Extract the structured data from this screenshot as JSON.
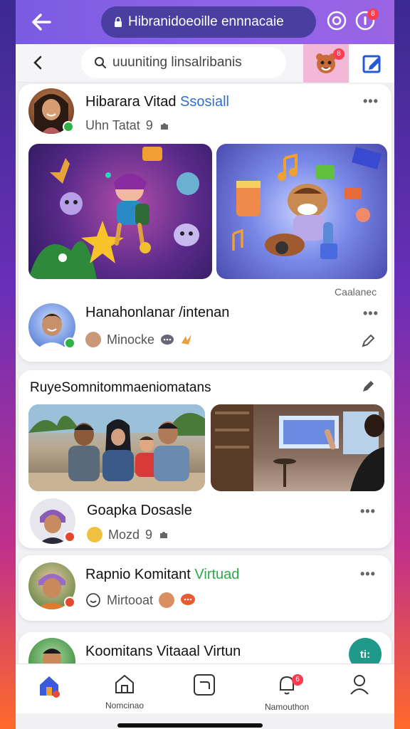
{
  "topbar": {
    "url_text": "Hibranidoeoille ennnacaie",
    "notif_count": "8"
  },
  "search": {
    "placeholder": "uuuniting linsalribanis",
    "avatar_badge": "8"
  },
  "feed": {
    "post1": {
      "name_main": "Hibarara Vitad ",
      "name_accent": "Ssosiall",
      "sub": "Uhn Tatat",
      "sub_num": "9",
      "caption": "Caalanec"
    },
    "post2": {
      "name": "Hanahonlanar /intenan",
      "sub": "Minocke"
    },
    "section": {
      "title": "RuyeSomnitommaeniomatans"
    },
    "post3": {
      "name": "Goapka Dosasle",
      "sub": "Mozd",
      "sub_num": "9"
    },
    "post4": {
      "name_main": "Rapnio Komitant ",
      "name_green": "Virtuad",
      "sub": "Mirtooat"
    },
    "post5": {
      "name": "Koomitans Vitaaal Virtun",
      "fab_label": "ti:"
    }
  },
  "nav": {
    "items": [
      {
        "label": ""
      },
      {
        "label": "Nomcinao"
      },
      {
        "label": ""
      },
      {
        "label": "Namouthon"
      },
      {
        "label": ""
      }
    ],
    "notif_badge": "6"
  },
  "colors": {
    "topbar": "#7a5ce0",
    "accent_blue": "#2f6fd6",
    "online_green": "#2fb344"
  }
}
